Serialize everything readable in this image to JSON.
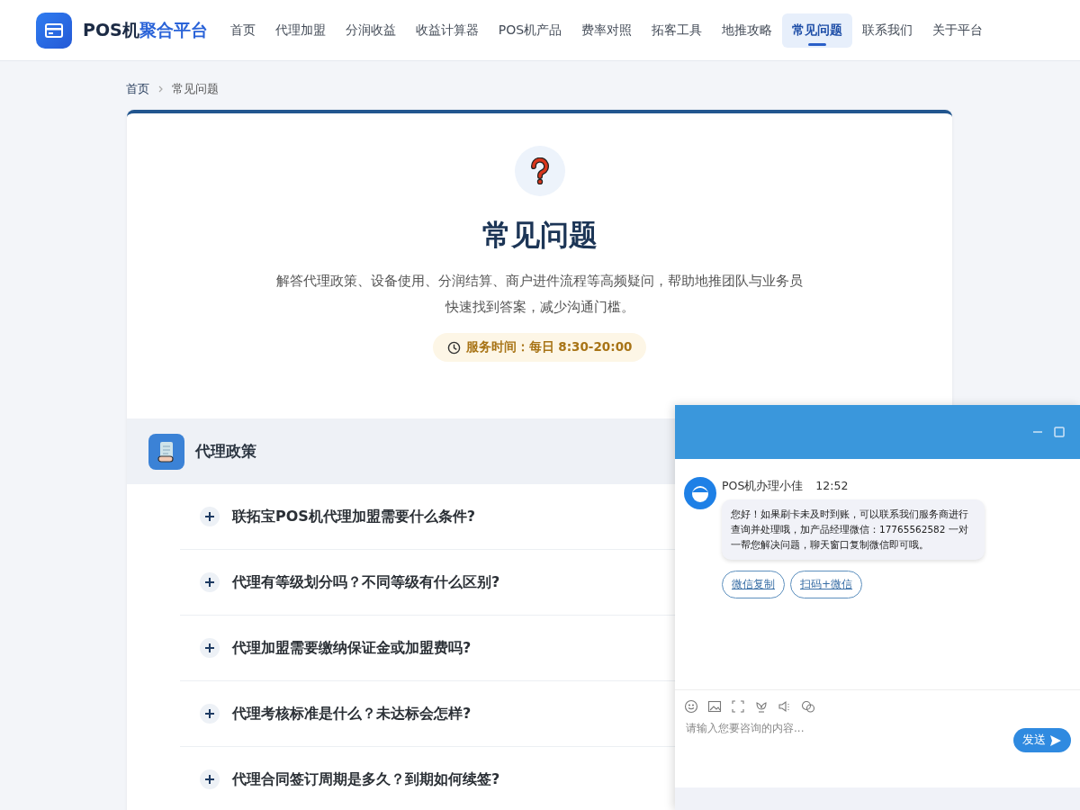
{
  "header": {
    "logo": {
      "text": "POS机",
      "accent": "聚合平台"
    },
    "nav": [
      {
        "label": "首页",
        "selected": false
      },
      {
        "label": "代理加盟",
        "selected": false
      },
      {
        "label": "分润收益",
        "selected": false
      },
      {
        "label": "收益计算器",
        "selected": false
      },
      {
        "label": "POS机产品",
        "selected": false
      },
      {
        "label": "费率对照",
        "selected": false
      },
      {
        "label": "拓客工具",
        "selected": false
      },
      {
        "label": "地推攻略",
        "selected": false
      },
      {
        "label": "常见问题",
        "selected": true
      },
      {
        "label": "联系我们",
        "selected": false
      },
      {
        "label": "关于平台",
        "selected": false
      }
    ]
  },
  "breadcrumb": [
    "首页",
    "常见问题"
  ],
  "hero": {
    "title": "常见问题",
    "description": "解答代理政策、设备使用、分润结算、商户进件流程等高频疑问，帮助地推团队与业务员快速找到答案，减少沟通门槛。",
    "service_time": "服务时间：每日 8:30-20:00"
  },
  "section": {
    "title": "代理政策",
    "questions": [
      {
        "text": "联拓宝POS机代理加盟需要什么条件?",
        "expanded": false
      },
      {
        "text": "代理有等级划分吗？不同等级有什么区别?",
        "expanded": false
      },
      {
        "text": "代理加盟需要缴纳保证金或加盟费吗?",
        "expanded": false
      },
      {
        "text": "代理考核标准是什么？未达标会怎样?",
        "expanded": false
      },
      {
        "text": "代理合同签订周期是多久？到期如何续签?",
        "expanded": false
      }
    ]
  },
  "chat": {
    "message": {
      "sender": "POS机办理小佳",
      "time": "12:52",
      "text": "您好！如果刷卡未及时到账，可以联系我们服务商进行查询并处理哦，加产品经理微信：17765562582 一对一帮您解决问题，聊天窗口复制微信即可哦。"
    },
    "actions": [
      "微信复制",
      "扫码+微信"
    ],
    "input": {
      "placeholder": "请输入您要咨询的内容..."
    },
    "send": "发送"
  }
}
